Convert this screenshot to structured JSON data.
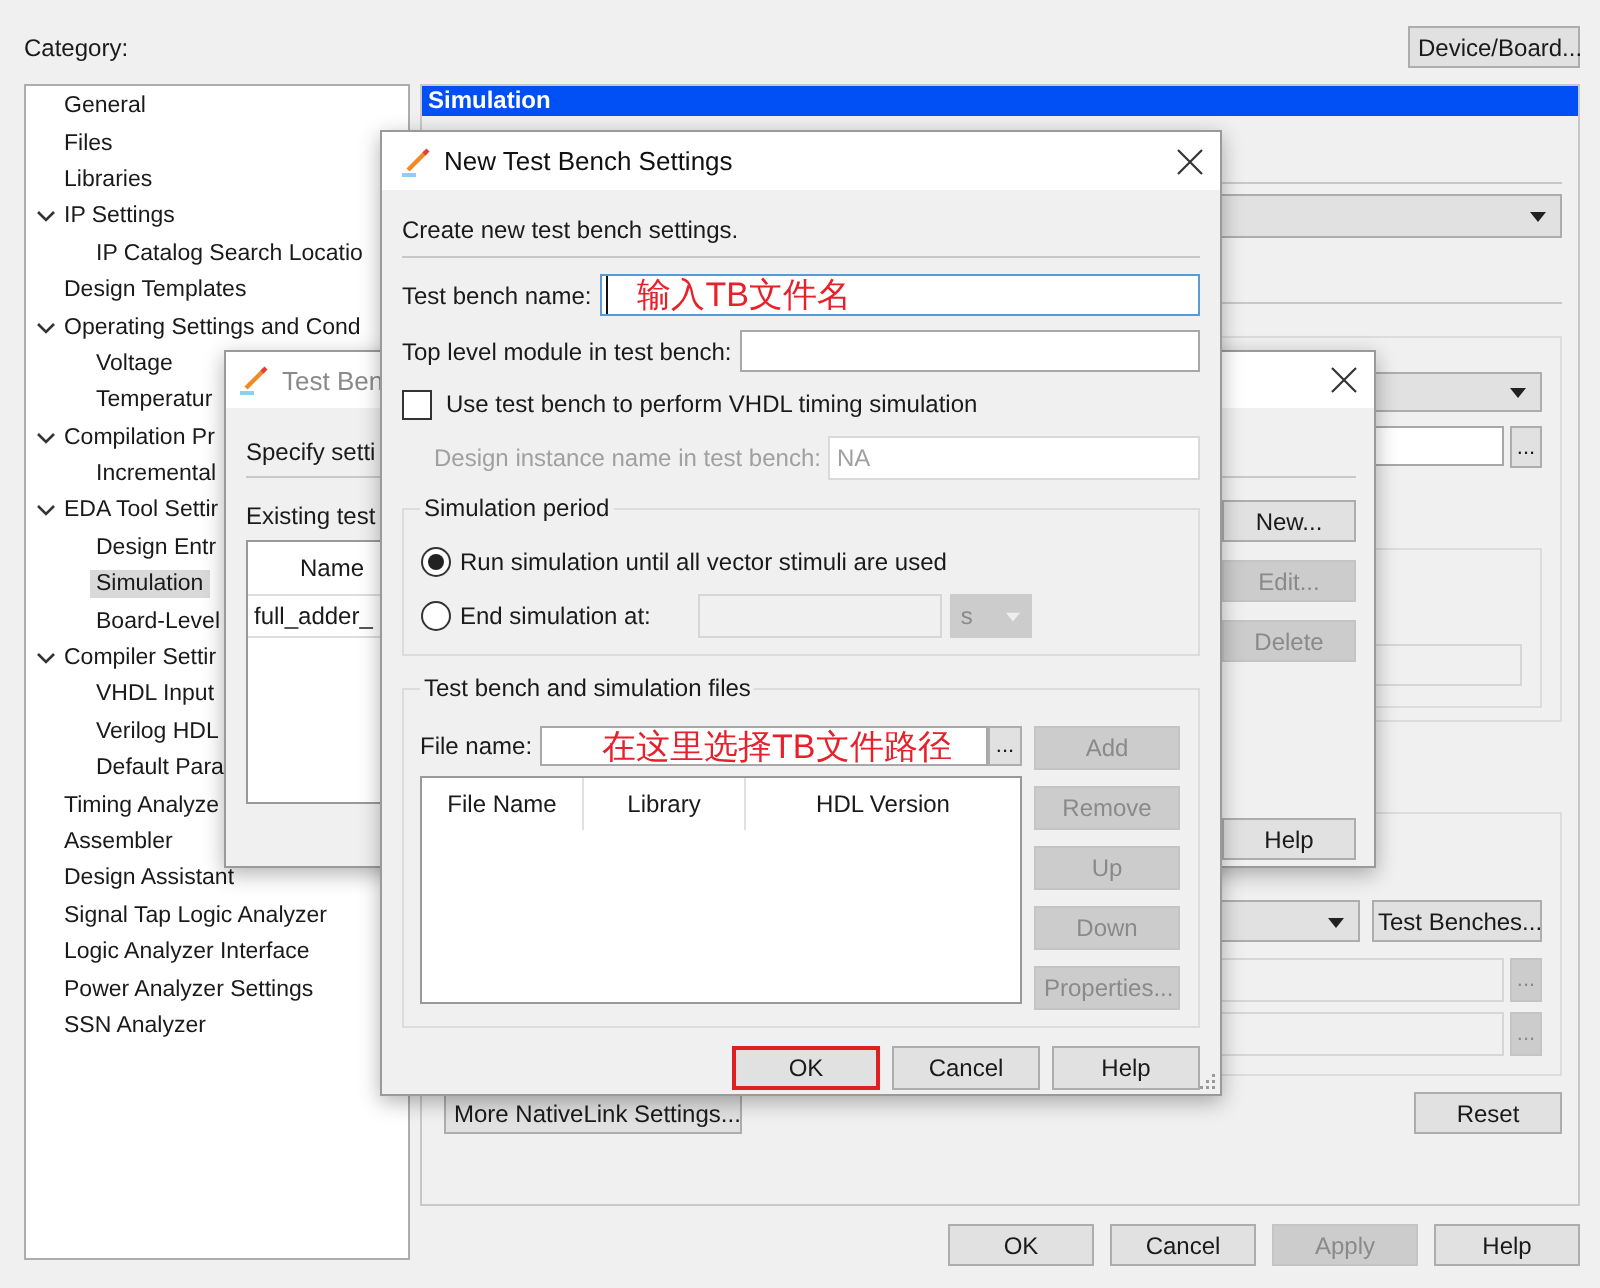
{
  "category_label": "Category:",
  "device_board_button": "Device/Board...",
  "category_tree": [
    {
      "label": "General",
      "selected": false
    },
    {
      "label": "Files",
      "selected": false
    },
    {
      "label": "Libraries",
      "selected": false
    },
    {
      "label": "IP Settings",
      "selected": false,
      "expanded": true,
      "children": [
        {
          "label": "IP Catalog Search Locatio",
          "selected": false
        }
      ]
    },
    {
      "label": "Design Templates",
      "selected": false
    },
    {
      "label": "Operating Settings and Cond",
      "selected": false,
      "expanded": true,
      "children": [
        {
          "label": "Voltage",
          "selected": false
        },
        {
          "label": "Temperatur",
          "selected": false
        }
      ]
    },
    {
      "label": "Compilation Pr",
      "selected": false,
      "expanded": true,
      "children": [
        {
          "label": "Incremental",
          "selected": false
        }
      ]
    },
    {
      "label": "EDA Tool Settir",
      "selected": false,
      "expanded": true,
      "children": [
        {
          "label": "Design Entr",
          "selected": false
        },
        {
          "label": "Simulation",
          "selected": true
        },
        {
          "label": "Board-Level",
          "selected": false
        }
      ]
    },
    {
      "label": "Compiler Settir",
      "selected": false,
      "expanded": true,
      "children": [
        {
          "label": "VHDL Input",
          "selected": false
        },
        {
          "label": "Verilog HDL",
          "selected": false
        },
        {
          "label": "Default Para",
          "selected": false
        }
      ]
    },
    {
      "label": "Timing Analyze",
      "selected": false
    },
    {
      "label": "Assembler",
      "selected": false
    },
    {
      "label": "Design Assistant",
      "selected": false
    },
    {
      "label": "Signal Tap Logic Analyzer",
      "selected": false
    },
    {
      "label": "Logic Analyzer Interface",
      "selected": false
    },
    {
      "label": "Power Analyzer Settings",
      "selected": false
    },
    {
      "label": "SSN Analyzer",
      "selected": false
    }
  ],
  "settings_panel": {
    "title": "Simulation",
    "browse_buttons": [
      {
        "label": "...",
        "disabled": false
      },
      {
        "label": "...",
        "disabled": true
      },
      {
        "label": "...",
        "disabled": true
      }
    ],
    "test_benches_button": "Test Benches...",
    "more_button": "More NativeLink Settings...",
    "reset_button": "Reset"
  },
  "dialog_buttons": [
    {
      "label": "OK",
      "disabled": false
    },
    {
      "label": "Cancel",
      "disabled": false
    },
    {
      "label": "Apply",
      "disabled": true
    },
    {
      "label": "Help",
      "disabled": false
    }
  ],
  "test_bench_dialog": {
    "title": "Test Ben",
    "intro": "Specify setti",
    "list_label": "Existing test",
    "columns": [
      "Name"
    ],
    "rows": [
      [
        "full_adder_"
      ]
    ],
    "buttons": [
      {
        "label": "New...",
        "disabled": false
      },
      {
        "label": "Edit...",
        "disabled": true
      },
      {
        "label": "Delete",
        "disabled": true
      },
      {
        "label": "Help",
        "disabled": false
      }
    ]
  },
  "new_test_bench_dialog": {
    "title": "New Test Bench Settings",
    "intro": "Create new test bench settings.",
    "test_bench_name": {
      "label": "Test bench name:",
      "value": "输入TB文件名"
    },
    "top_level_module": {
      "label": "Top level module in test bench:"
    },
    "vhdl_timing": {
      "label": "Use test bench to perform VHDL timing simulation",
      "checked": false
    },
    "design_instance": {
      "label": "Design instance name in test bench:",
      "value": "NA",
      "disabled": true
    },
    "simulation_period": {
      "title": "Simulation period",
      "options": [
        {
          "label": "Run simulation until all vector stimuli are used",
          "selected": true
        },
        {
          "label": "End simulation at:",
          "selected": false
        }
      ],
      "end_time": {
        "unit": "s",
        "disabled": true
      }
    },
    "files": {
      "title": "Test bench and simulation files",
      "file_name_label": "File name:",
      "file_name_value": "在这里选择TB文件路径",
      "browse": "...",
      "columns": [
        "File Name",
        "Library",
        "HDL Version"
      ],
      "buttons": [
        {
          "label": "Add",
          "disabled": true
        },
        {
          "label": "Remove",
          "disabled": true
        },
        {
          "label": "Up",
          "disabled": true
        },
        {
          "label": "Down",
          "disabled": true
        },
        {
          "label": "Properties...",
          "disabled": true
        }
      ]
    },
    "buttons": [
      {
        "label": "OK",
        "highlighted": true
      },
      {
        "label": "Cancel",
        "highlighted": false
      },
      {
        "label": "Help",
        "highlighted": false
      }
    ]
  }
}
